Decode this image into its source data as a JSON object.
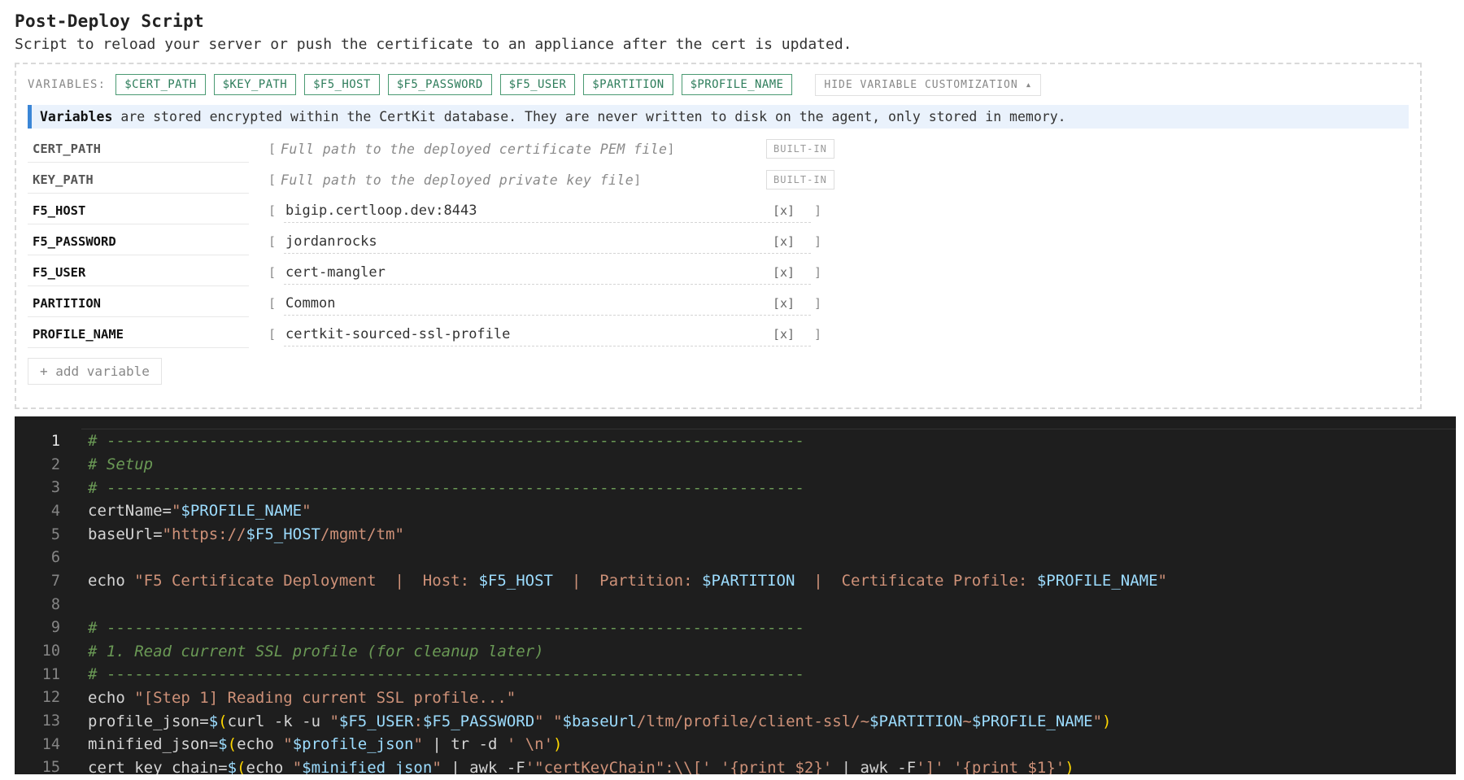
{
  "header": {
    "title": "Post-Deploy Script",
    "subtitle": "Script to reload your server or push the certificate to an appliance after the cert is updated."
  },
  "variables_bar": {
    "label": "VARIABLES:",
    "chips": [
      "$CERT_PATH",
      "$KEY_PATH",
      "$F5_HOST",
      "$F5_PASSWORD",
      "$F5_USER",
      "$PARTITION",
      "$PROFILE_NAME"
    ],
    "hide_label": "HIDE VARIABLE CUSTOMIZATION ▴"
  },
  "notice": {
    "bold": "Variables",
    "text": " are stored encrypted within the CertKit database. They are never written to disk on the agent, only stored in memory."
  },
  "builtins": [
    {
      "name": "CERT_PATH",
      "placeholder": "Full path to the deployed certificate PEM file",
      "badge": "BUILT-IN"
    },
    {
      "name": "KEY_PATH",
      "placeholder": "Full path to the deployed private key file",
      "badge": "BUILT-IN"
    }
  ],
  "custom_vars": [
    {
      "name": "F5_HOST",
      "value": "bigip.certloop.dev:8443"
    },
    {
      "name": "F5_PASSWORD",
      "value": "jordanrocks"
    },
    {
      "name": "F5_USER",
      "value": "cert-mangler"
    },
    {
      "name": "PARTITION",
      "value": "Common"
    },
    {
      "name": "PROFILE_NAME",
      "value": "certkit-sourced-ssl-profile"
    }
  ],
  "bracket_open": "[",
  "bracket_close": "]",
  "remove_label": "[x]",
  "add_variable_label": "+ add variable",
  "editor": {
    "line_numbers": [
      "1",
      "2",
      "3",
      "4",
      "5",
      "6",
      "7",
      "8",
      "9",
      "10",
      "11",
      "12",
      "13",
      "14",
      "15"
    ],
    "lines": [
      "# ---------------------------------------------------------------------------",
      "# Setup",
      "# ---------------------------------------------------------------------------",
      "certName=\"$PROFILE_NAME\"",
      "baseUrl=\"https://$F5_HOST/mgmt/tm\"",
      "",
      "echo \"F5 Certificate Deployment  |  Host: $F5_HOST  |  Partition: $PARTITION  |  Certificate Profile: $PROFILE_NAME\"",
      "",
      "# ---------------------------------------------------------------------------",
      "# 1. Read current SSL profile (for cleanup later)",
      "# ---------------------------------------------------------------------------",
      "echo \"[Step 1] Reading current SSL profile...\"",
      "profile_json=$(curl -k -u \"$F5_USER:$F5_PASSWORD\" \"$baseUrl/ltm/profile/client-ssl/~$PARTITION~$PROFILE_NAME\")",
      "minified_json=$(echo \"$profile_json\" | tr -d ' \\n')",
      "cert_key_chain=$(echo \"$minified_json\" | awk -F'\"certKeyChain\":\\\\[' '{print $2}' | awk -F']' '{print $1}')"
    ]
  }
}
